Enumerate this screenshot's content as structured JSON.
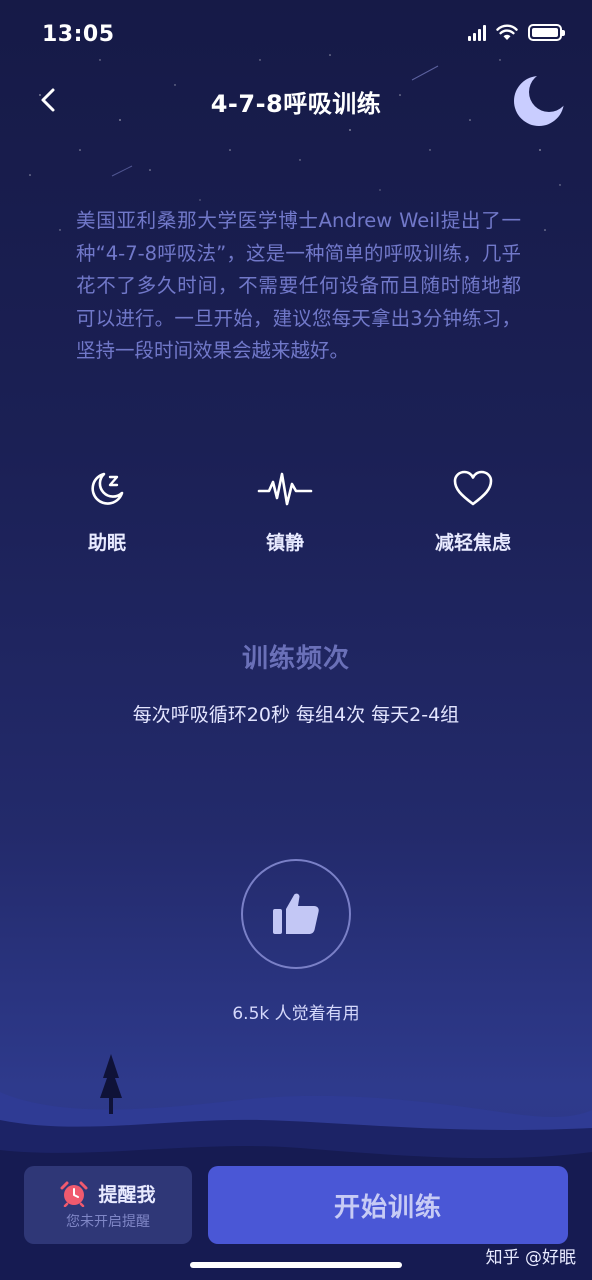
{
  "status_bar": {
    "time": "13:05"
  },
  "nav": {
    "title": "4-7-8呼吸训练"
  },
  "description": "美国亚利桑那大学医学博士Andrew Weil提出了一种“4-7-8呼吸法”，这是一种简单的呼吸训练，几乎花不了多久时间，不需要任何设备而且随时随地都可以进行。一旦开始，建议您每天拿出3分钟练习，坚持一段时间效果会越来越好。",
  "features": [
    {
      "label": "助眠",
      "icon": "moon-sleep-icon"
    },
    {
      "label": "镇静",
      "icon": "heartbeat-wave-icon"
    },
    {
      "label": "减轻焦虑",
      "icon": "heart-icon"
    }
  ],
  "frequency": {
    "title": "训练频次",
    "detail": "每次呼吸循环20秒 每组4次 每天2-4组"
  },
  "like": {
    "icon": "thumbs-up-icon",
    "count_text": "6.5k 人觉着有用"
  },
  "remind": {
    "label": "提醒我",
    "sub": "您未开启提醒",
    "icon": "alarm-clock-icon"
  },
  "start": {
    "label": "开始训练"
  },
  "watermark": "知乎 @好眠",
  "colors": {
    "accent": "#4a57d6",
    "background_top": "#161a47",
    "background_bottom": "#2e3a8c",
    "alarm": "#f05a6e"
  }
}
